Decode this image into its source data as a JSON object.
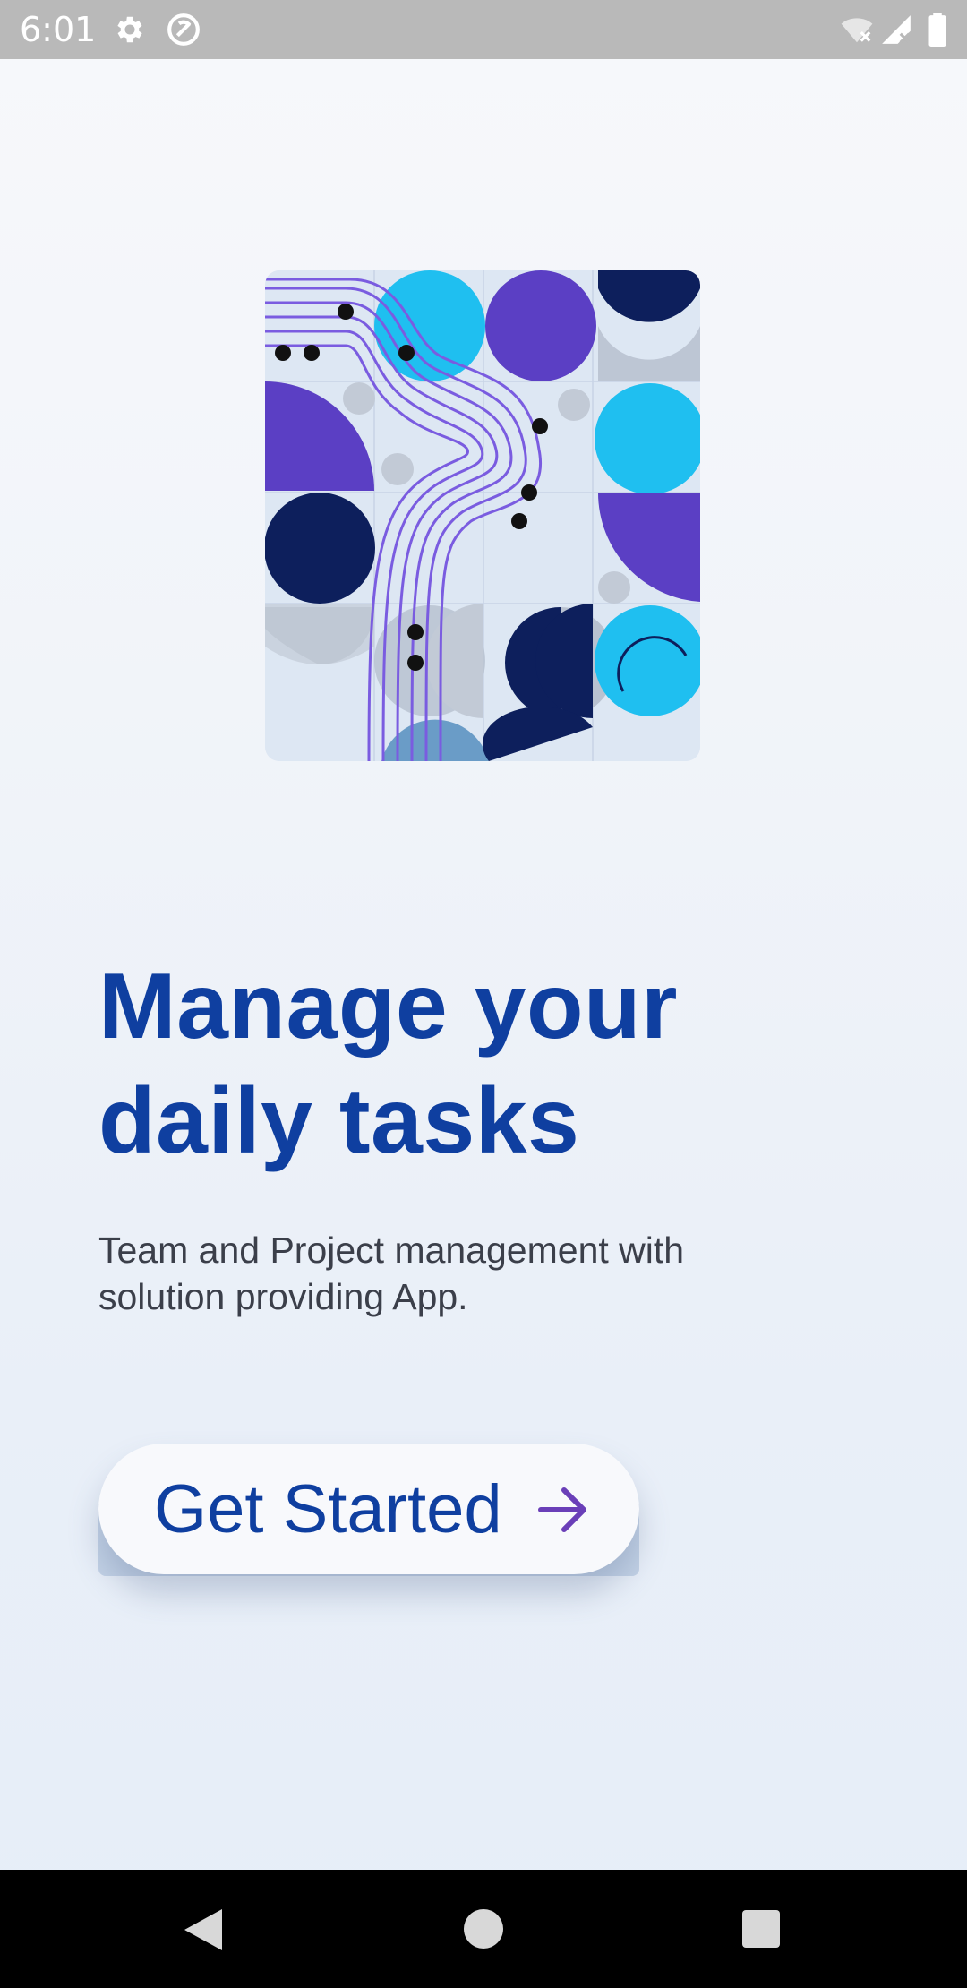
{
  "status_bar": {
    "time": "6:01",
    "icons": [
      "gear-icon",
      "sync-icon",
      "wifi-off-icon",
      "signal-off-icon",
      "battery-icon"
    ]
  },
  "hero": {
    "icon": "abstract-geometric-illustration",
    "colors": {
      "navy": "#0d1f5c",
      "purple": "#5b3fc4",
      "cyan": "#1fbff0",
      "grey": "#b9c2d0",
      "background": "#dde7f3"
    }
  },
  "headline": {
    "line1": "Manage your",
    "line2": "daily tasks"
  },
  "subtitle": {
    "line1": "Team and Project management with",
    "line2": "solution providing App."
  },
  "cta": {
    "label": "Get Started",
    "icon": "arrow-right-icon"
  },
  "nav_bar": {
    "icons": [
      "back-icon",
      "home-icon",
      "recents-icon"
    ]
  },
  "theme": {
    "accent": "#0f3fa0",
    "arrow": "#6a3fb8",
    "text": "#3b3f4a"
  }
}
